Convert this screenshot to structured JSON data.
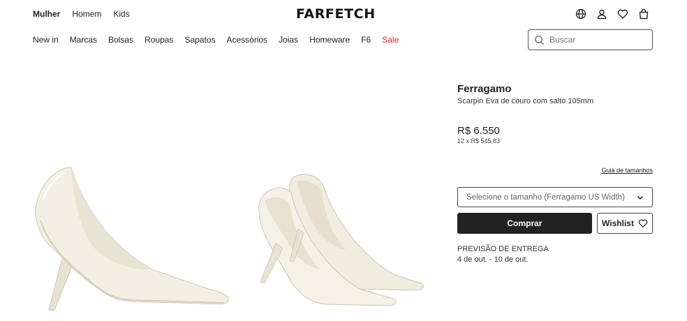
{
  "header": {
    "gender_tabs": [
      "Mulher",
      "Homem",
      "Kids"
    ],
    "logo": "FARFETCH",
    "icons": [
      "globe-icon",
      "account-icon",
      "wishlist-heart-icon",
      "bag-icon"
    ]
  },
  "categories": [
    "New in",
    "Marcas",
    "Bolsas",
    "Roupas",
    "Sapatos",
    "Acessórios",
    "Joias",
    "Homeware",
    "F6",
    "Sale"
  ],
  "search": {
    "placeholder": "Buscar"
  },
  "product": {
    "brand": "Ferragamo",
    "name": "Scarpin Eva de couro com salto 105mm",
    "price": "R$ 6.550",
    "installments": "12 x R$ 545,83",
    "size_guide": "Guia de tamanhos",
    "size_select": "Selecione o tamanho (Ferragamo US Width)",
    "buy_label": "Comprar",
    "wishlist_label": "Wishlist",
    "delivery_title": "PREVISÃO DE ENTREGA",
    "delivery_dates": "4 de out. - 10 de out."
  },
  "colors": {
    "sale": "#d3261e",
    "primary_button": "#222222",
    "shoe": "#f3efe4"
  }
}
